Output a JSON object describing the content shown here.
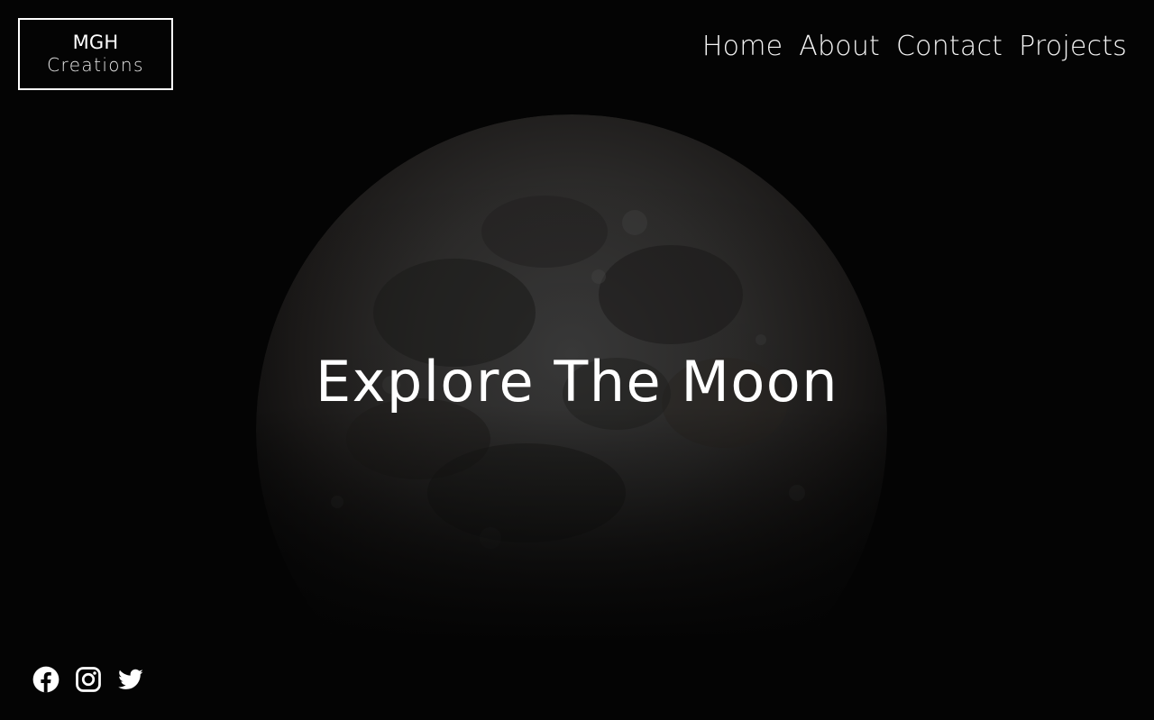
{
  "logo": {
    "line1": "MGH",
    "line2": "Creations"
  },
  "nav": {
    "items": [
      {
        "label": "Home"
      },
      {
        "label": "About"
      },
      {
        "label": "Contact"
      },
      {
        "label": "Projects"
      }
    ]
  },
  "hero": {
    "title": "Explore The Moon"
  },
  "social": {
    "icons": [
      "facebook-icon",
      "instagram-icon",
      "twitter-icon"
    ]
  },
  "colors": {
    "background": "#040404",
    "text": "#ffffff",
    "moon_surface": "#2a2a2a"
  }
}
